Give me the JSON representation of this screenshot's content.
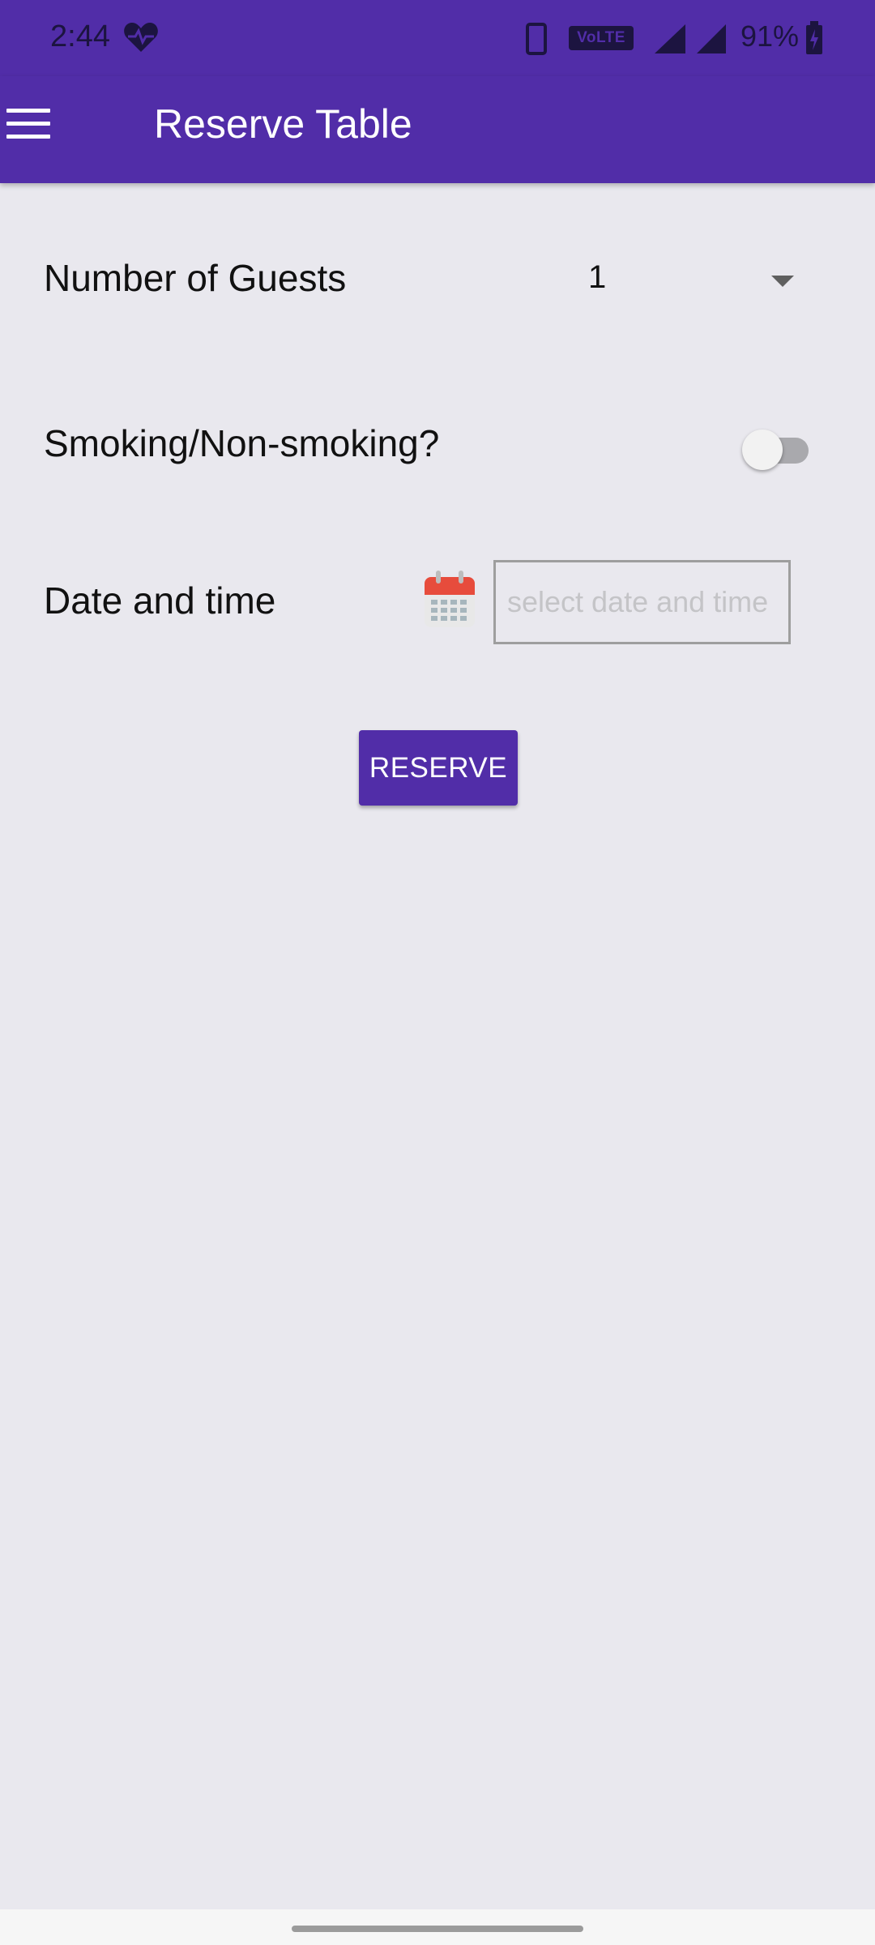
{
  "status_bar": {
    "time": "2:44",
    "volte_label": "VoLTE",
    "battery_percent": "91%"
  },
  "app_bar": {
    "title": "Reserve Table"
  },
  "form": {
    "guests_label": "Number of Guests",
    "guests_value": "1",
    "smoking_label": "Smoking/Non-smoking?",
    "smoking_on": false,
    "date_label": "Date and time",
    "date_placeholder": "select date and time",
    "date_value": "",
    "reserve_label": "RESERVE"
  },
  "colors": {
    "primary": "#512da8",
    "background": "#e9e8ee",
    "calendar_red": "#e74c3c"
  },
  "icons": [
    "heart-icon",
    "phone-icon",
    "signal-icon",
    "battery-icon",
    "menu-icon",
    "dropdown-arrow-icon",
    "calendar-icon"
  ]
}
